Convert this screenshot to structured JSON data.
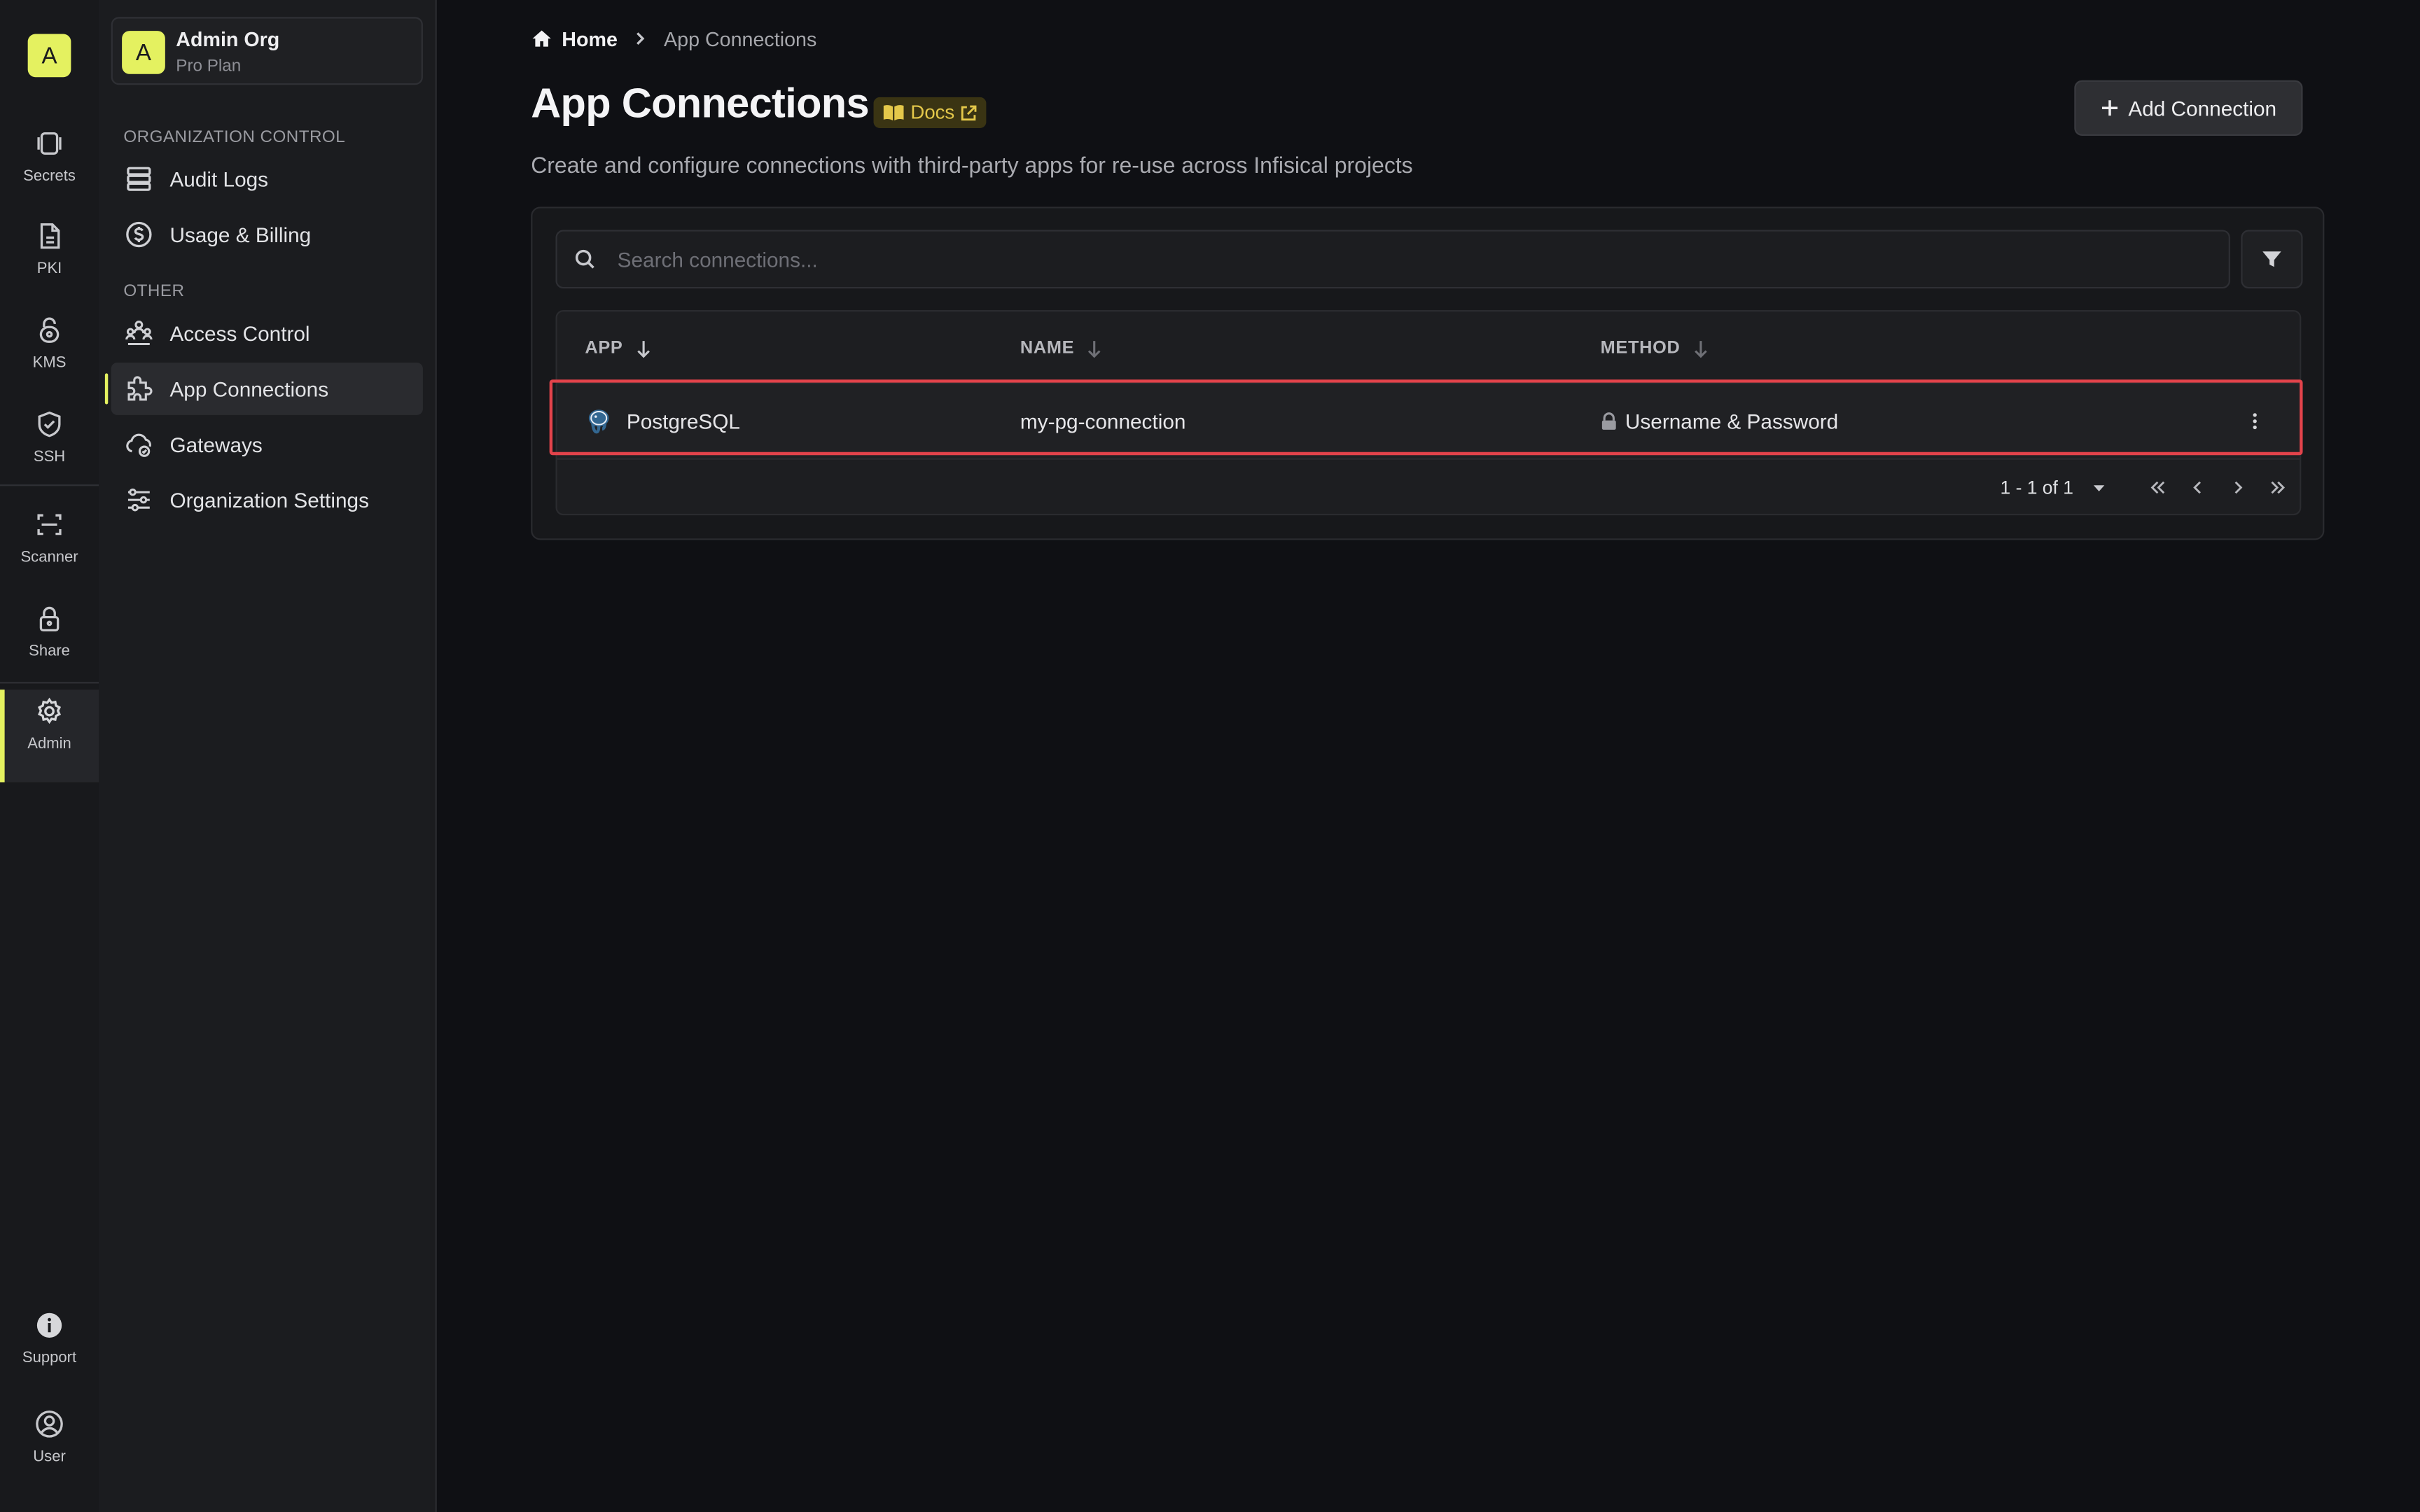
{
  "rail": {
    "logo": "A",
    "items": [
      {
        "label": "Secrets",
        "icon": "secrets-icon"
      },
      {
        "label": "PKI",
        "icon": "pki-icon"
      },
      {
        "label": "KMS",
        "icon": "kms-icon"
      },
      {
        "label": "SSH",
        "icon": "ssh-icon"
      },
      {
        "label": "Scanner",
        "icon": "scanner-icon"
      },
      {
        "label": "Share",
        "icon": "share-icon"
      },
      {
        "label": "Admin",
        "icon": "admin-icon"
      },
      {
        "label": "Support",
        "icon": "support-icon"
      },
      {
        "label": "User",
        "icon": "user-icon"
      }
    ],
    "active": "Admin"
  },
  "org": {
    "avatar": "A",
    "name": "Admin Org",
    "plan": "Pro Plan"
  },
  "sidebar": {
    "section_org_control": "ORGANIZATION CONTROL",
    "section_other": "OTHER",
    "items": [
      {
        "label": "Audit Logs",
        "icon": "audit-logs-icon"
      },
      {
        "label": "Usage & Billing",
        "icon": "billing-icon"
      },
      {
        "label": "Access Control",
        "icon": "access-control-icon"
      },
      {
        "label": "App Connections",
        "icon": "app-connections-icon"
      },
      {
        "label": "Gateways",
        "icon": "gateways-icon"
      },
      {
        "label": "Organization Settings",
        "icon": "settings-icon"
      }
    ],
    "active": "App Connections"
  },
  "breadcrumb": {
    "home": "Home",
    "current": "App Connections"
  },
  "page": {
    "title": "App Connections",
    "docs_label": "Docs",
    "description": "Create and configure connections with third-party apps for re-use across Infisical projects",
    "add_button": "Add Connection"
  },
  "search": {
    "placeholder": "Search connections..."
  },
  "table": {
    "columns": [
      "APP",
      "NAME",
      "METHOD"
    ],
    "rows": [
      {
        "app": "PostgreSQL",
        "name": "my-pg-connection",
        "method": "Username & Password"
      }
    ]
  },
  "pagination": {
    "range": "1 - 1 of 1"
  },
  "colors": {
    "accent": "#e4f160",
    "highlight": "#e2434b",
    "docs": "#e4c84a"
  }
}
